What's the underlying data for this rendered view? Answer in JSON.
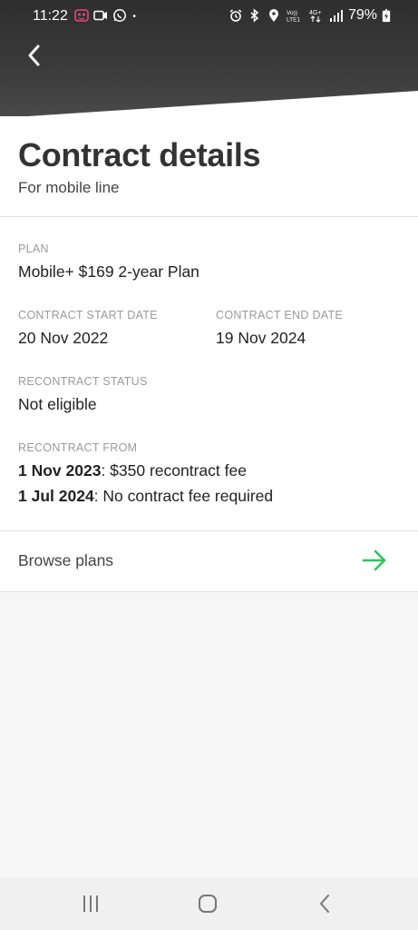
{
  "status_bar": {
    "time": "11:22",
    "battery_percent": "79%",
    "network_label": "4G+",
    "volte_label": "Vo)) LTE1"
  },
  "header": {
    "back_icon": "chevron-left-icon",
    "title": "Contract details",
    "subtitle": "For mobile line"
  },
  "details": {
    "plan_label": "PLAN",
    "plan_value": "Mobile+ $169 2-year Plan",
    "start_label": "CONTRACT START DATE",
    "start_value": "20 Nov 2022",
    "end_label": "CONTRACT END DATE",
    "end_value": "19 Nov 2024",
    "status_label": "RECONTRACT STATUS",
    "status_value": "Not eligible",
    "from_label": "RECONTRACT FROM",
    "from_items": [
      {
        "date": "1 Nov 2023",
        "text": ": $350 recontract fee"
      },
      {
        "date": "1 Jul 2024",
        "text": ": No contract fee required"
      }
    ]
  },
  "browse": {
    "label": "Browse plans",
    "icon": "arrow-right-icon",
    "accent_color": "#2ec45a"
  },
  "nav": {
    "recents_icon": "recents-icon",
    "home_icon": "home-icon",
    "back_icon": "back-icon"
  }
}
